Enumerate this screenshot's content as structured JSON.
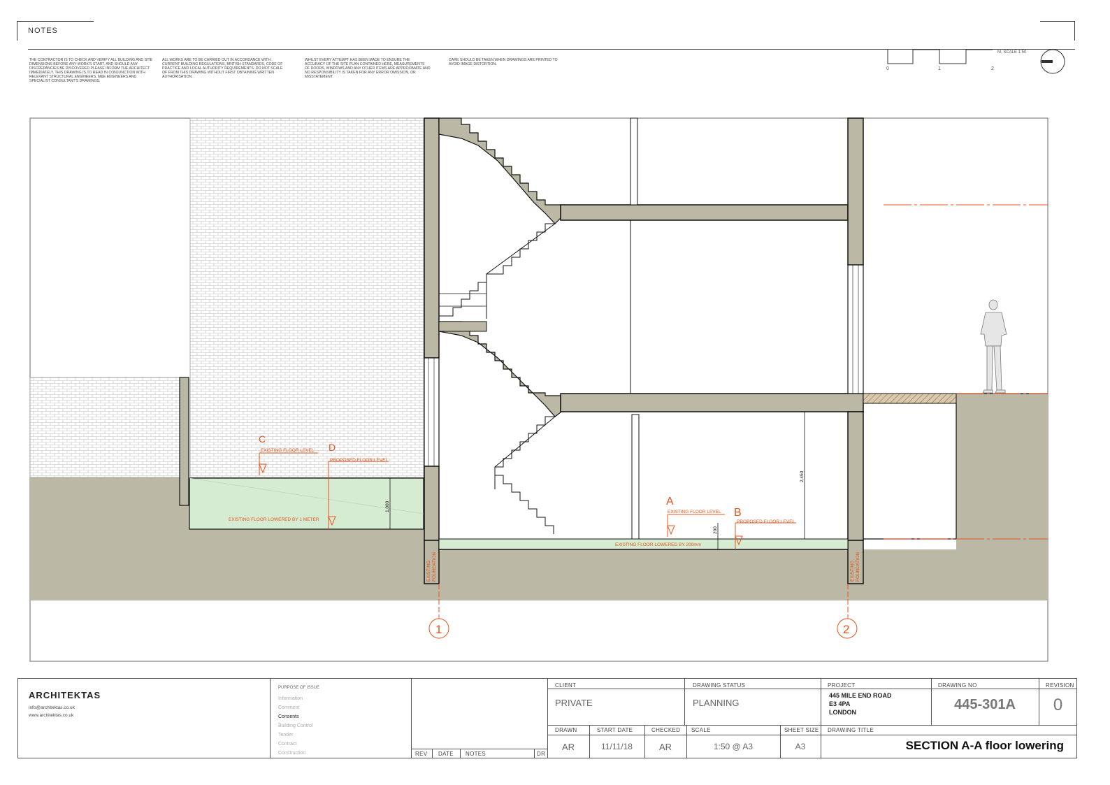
{
  "notes": {
    "title": "NOTES",
    "col1": "THE CONTRACTOR IS TO CHECK AND VERIFY ALL BUILDING AND SITE DIMENSIONS BEFORE ANY WORK'S START. AND SHOULD ANY DISCREPANCIES BE DISCOVERED PLEASE INFORM THE ARCHITECT IMMEDIATELY. THIS DRAWING IS TO READ IN CONJUNCTION WITH RELEVANT STRUCTURAL ENGINEERS, M&E ENGINEERS AND SPECIALIST CONSULTANT'S DRAWINGS.",
    "col2": "ALL WORKS ARE TO BE CARRIED OUT IN ACCORDANCE WITH CURRENT BUILDING REGULATIONS, BRITISH STANDARDS, CODE OF PRACTICE AND LOCAL AUTHORITY REQUIREMENTS. DO NOT SCALE OF FROM THIS DRAWING WITHOUT FIRST OBTAINING WRITTEN AUTHORISATION.",
    "col3": "WHILST EVERY ATTEMPT HAS BEEN MADE TO ENSURE THE ACCURACY OF THE SITE PLAN CONTAINED HERE, MEASUREMENTS OF DOORS, WINDOWS AND ANY OTHER ITEMS ARE APPROXIMATE AND NO RESPONSIBILITY IS TAKEN FOR ANY ERROR OMISSION, OR MISSTATEMENT.",
    "col4": "CARE SHOULD BE TAKEN WHEN DRAWINGS ARE PRINTED TO AVOID IMAGE DISTORTION."
  },
  "scale_bar": {
    "label": "M, SCALE 1:50",
    "ticks": [
      "0",
      "1",
      "2"
    ]
  },
  "annotations": {
    "left_c": "C",
    "left_d": "D",
    "left_existing": "EXISTING FLOOR LEVEL",
    "left_proposed": "PROPOSED FLOOR LEVEL",
    "left_lowered": "EXISTING FLOOR LOWERED BY 1 METER",
    "dim_left": "1,000",
    "a": "A",
    "b": "B",
    "mid_existing": "EXISTING FLOOR LEVEL",
    "mid_proposed": "PROPOSED FLOOR LEVEL",
    "mid_lowered": "EXISTING FLOOR LOWERED BY 200mm",
    "dim_200": "200",
    "dim_2450": "2,450",
    "foundation_left": [
      "EXISTING",
      "FOUNDATION"
    ],
    "foundation_right": [
      "EXISTING",
      "FOUNDATION"
    ],
    "grid_1": "1",
    "grid_2": "2"
  },
  "title_block": {
    "company": "ARCHITEKTAS",
    "email": "info@architektas.co.uk",
    "web": "www.architektas.co.uk",
    "purpose_label": "PURPOSE OF ISSUE",
    "purpose_items": [
      "Information",
      "Comment",
      "Consents",
      "Building Control",
      "Tender",
      "Contract",
      "Construction"
    ],
    "purpose_active": "Consents",
    "rev_cols": [
      "REV",
      "DATE",
      "NOTES",
      "DR"
    ],
    "client_label": "CLIENT",
    "client": "PRIVATE",
    "status_label": "DRAWING STATUS",
    "status": "PLANNING",
    "project_label": "PROJECT",
    "project_lines": [
      "445 MILE END ROAD",
      "E3 4PA",
      "LONDON"
    ],
    "drawing_no_label": "DRAWING NO",
    "drawing_no": "445-301A",
    "revision_label": "REVISION",
    "revision": "0",
    "drawn_label": "DRAWN",
    "drawn": "AR",
    "start_date_label": "START DATE",
    "start_date": "11/11/18",
    "checked_label": "CHECKED",
    "checked": "AR",
    "scale_label": "SCALE",
    "scale": "1:50 @ A3",
    "sheet_size_label": "SHEET SIZE",
    "sheet_size": "A3",
    "drawing_title_label": "DRAWING TITLE",
    "drawing_title": "SECTION A-A floor lowering"
  },
  "colors": {
    "wall": "#bbb8a5",
    "green": "#d6ecd2",
    "red": "#e8541c",
    "line": "#111111"
  }
}
